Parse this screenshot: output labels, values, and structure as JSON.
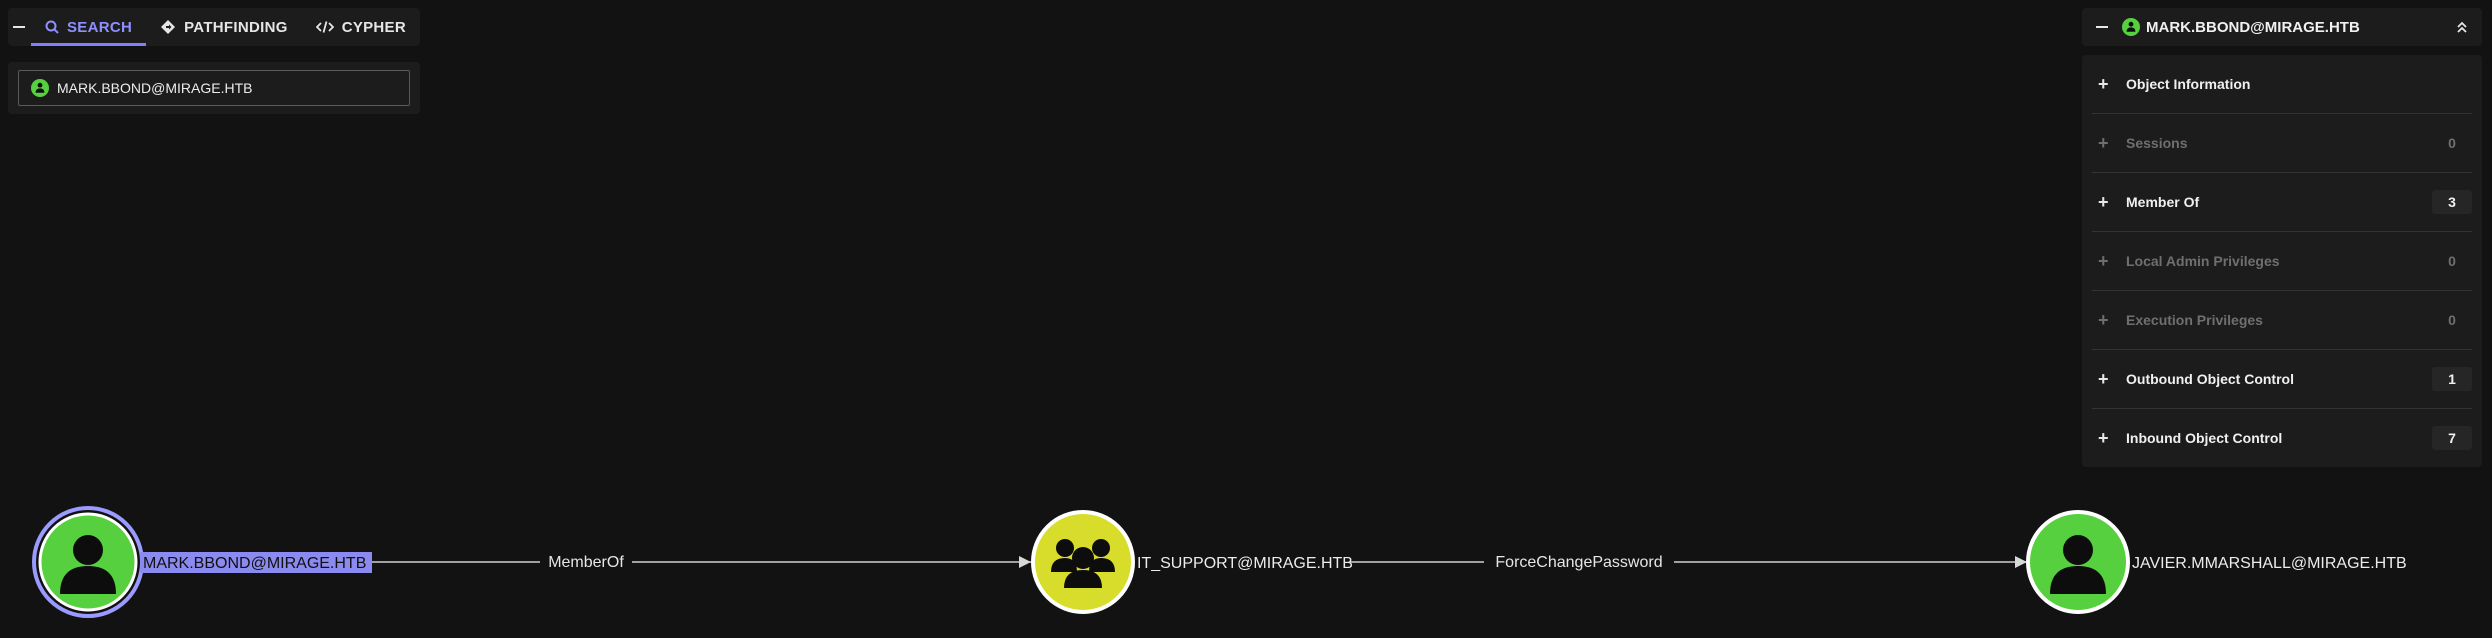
{
  "tabs": [
    {
      "label": "SEARCH",
      "icon": "search-icon"
    },
    {
      "label": "PATHFINDING",
      "icon": "pathfinding-icon"
    },
    {
      "label": "CYPHER",
      "icon": "code-icon"
    }
  ],
  "search": {
    "value": "MARK.BBOND@MIRAGE.HTB",
    "icon": "user-icon"
  },
  "info": {
    "title": "MARK.BBOND@MIRAGE.HTB",
    "sections": [
      {
        "label": "Object Information",
        "count": "",
        "enabled": true
      },
      {
        "label": "Sessions",
        "count": "0",
        "enabled": false
      },
      {
        "label": "Member Of",
        "count": "3",
        "enabled": true
      },
      {
        "label": "Local Admin Privileges",
        "count": "0",
        "enabled": false
      },
      {
        "label": "Execution Privileges",
        "count": "0",
        "enabled": false
      },
      {
        "label": "Outbound Object Control",
        "count": "1",
        "enabled": true
      },
      {
        "label": "Inbound Object Control",
        "count": "7",
        "enabled": true
      }
    ]
  },
  "graph": {
    "nodes": [
      {
        "label": "MARK.BBOND@MIRAGE.HTB",
        "type": "user",
        "color": "#56d03e",
        "selected": true
      },
      {
        "label": "IT_SUPPORT@MIRAGE.HTB",
        "type": "group",
        "color": "#d8dd2b",
        "selected": false
      },
      {
        "label": "JAVIER.MMARSHALL@MIRAGE.HTB",
        "type": "user",
        "color": "#56d03e",
        "selected": false
      }
    ],
    "edges": [
      {
        "label": "MemberOf"
      },
      {
        "label": "ForceChangePassword"
      }
    ]
  },
  "colors": {
    "accent": "#7f7fff",
    "selection_highlight": "#8a8af0",
    "user_node": "#56d03e",
    "group_node": "#d8dd2b"
  }
}
